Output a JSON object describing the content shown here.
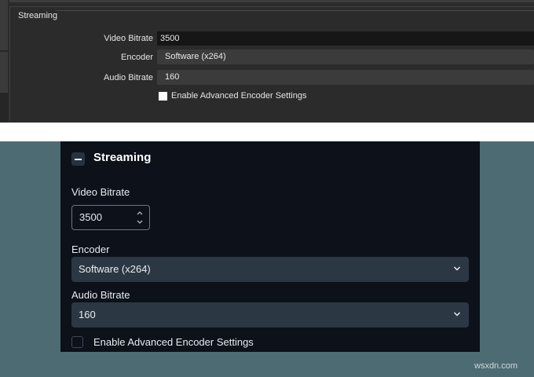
{
  "old_ui": {
    "section_title": "Streaming",
    "video_bitrate_label": "Video Bitrate",
    "video_bitrate_value": "3500",
    "encoder_label": "Encoder",
    "encoder_value": "Software (x264)",
    "audio_bitrate_label": "Audio Bitrate",
    "audio_bitrate_value": "160",
    "advanced_checkbox_label": "Enable Advanced Encoder Settings",
    "advanced_checked": false
  },
  "new_ui": {
    "section_title": "Streaming",
    "video_bitrate_label": "Video Bitrate",
    "video_bitrate_value": "3500",
    "encoder_label": "Encoder",
    "encoder_value": "Software (x264)",
    "audio_bitrate_label": "Audio Bitrate",
    "audio_bitrate_value": "160",
    "advanced_checkbox_label": "Enable Advanced Encoder Settings",
    "advanced_checked": false
  },
  "icons": {
    "collapse": "minus-icon",
    "spinner": "spin-arrows-icon",
    "dropdown": "chevron-down-icon"
  },
  "colors": {
    "old_bg": "#2b2b2b",
    "new_panel_bg": "#0c111a",
    "new_outer_bg": "#4d6b72",
    "select_bg": "#2b3742"
  },
  "watermark": "wsxdn.com"
}
